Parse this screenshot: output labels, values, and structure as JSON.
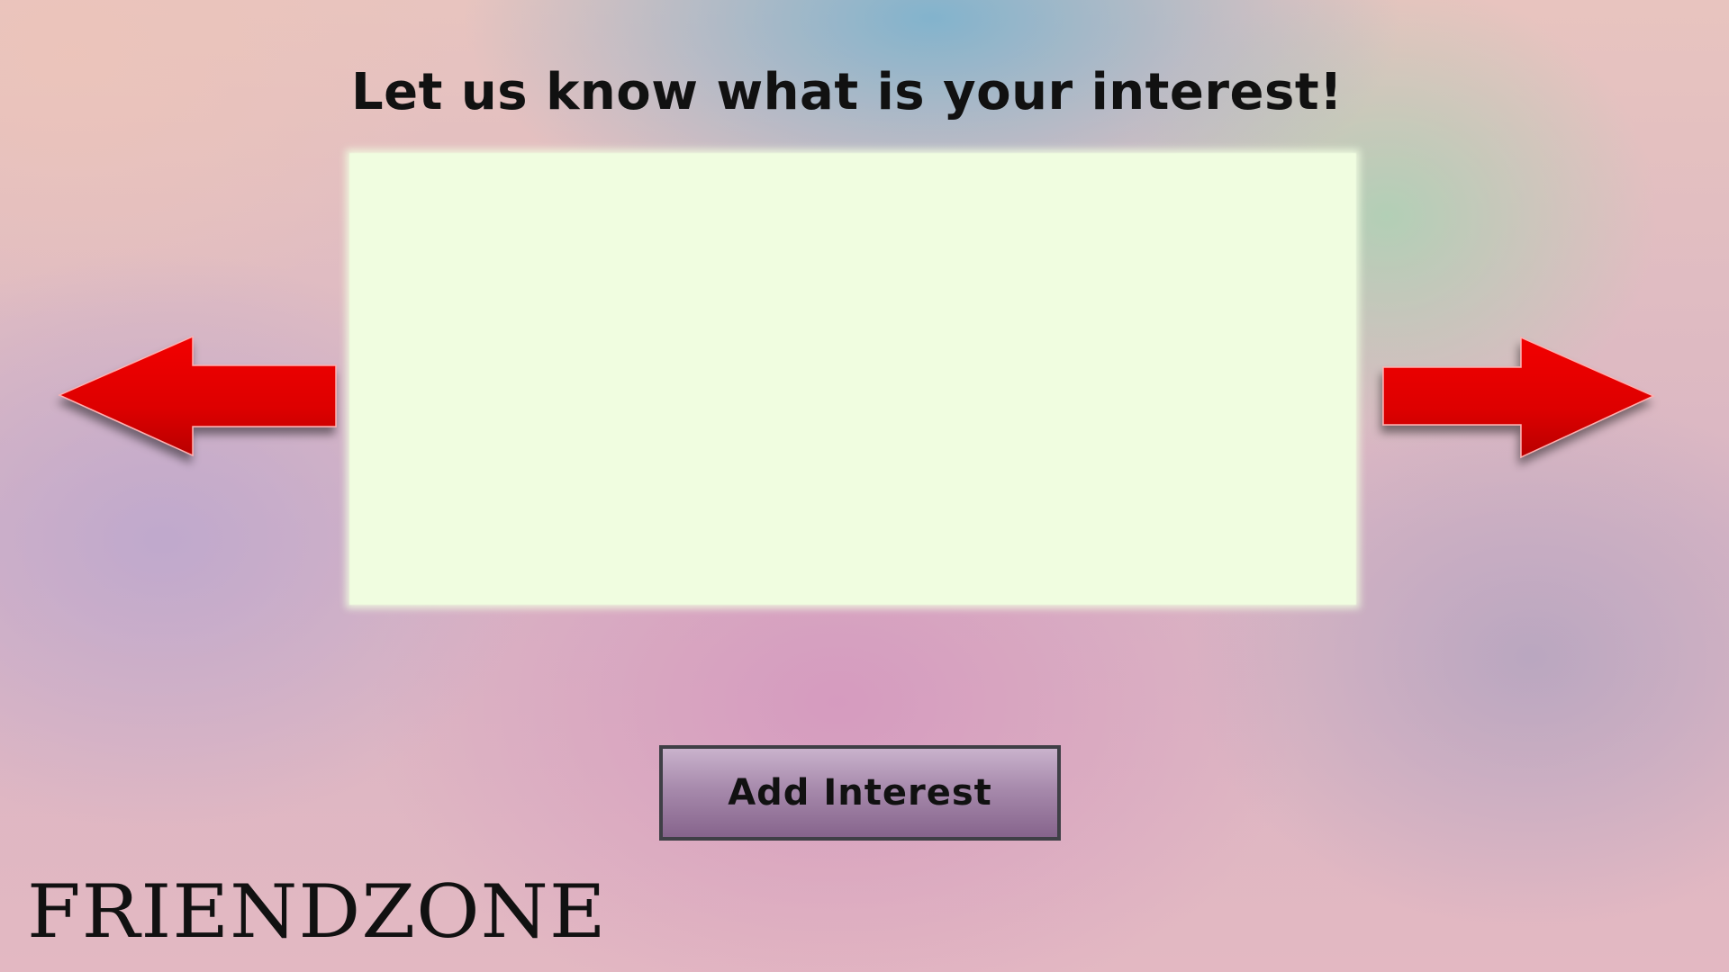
{
  "heading": "Let us know what is your interest!",
  "navigation": {
    "previous_icon": "arrow-left-icon",
    "next_icon": "arrow-right-icon",
    "arrow_color": "#e00000"
  },
  "interest_panel": {
    "color": "#f0fde0"
  },
  "actions": {
    "add_interest_label": "Add Interest"
  },
  "brand": {
    "logo_text": "FRIENDZONE"
  }
}
